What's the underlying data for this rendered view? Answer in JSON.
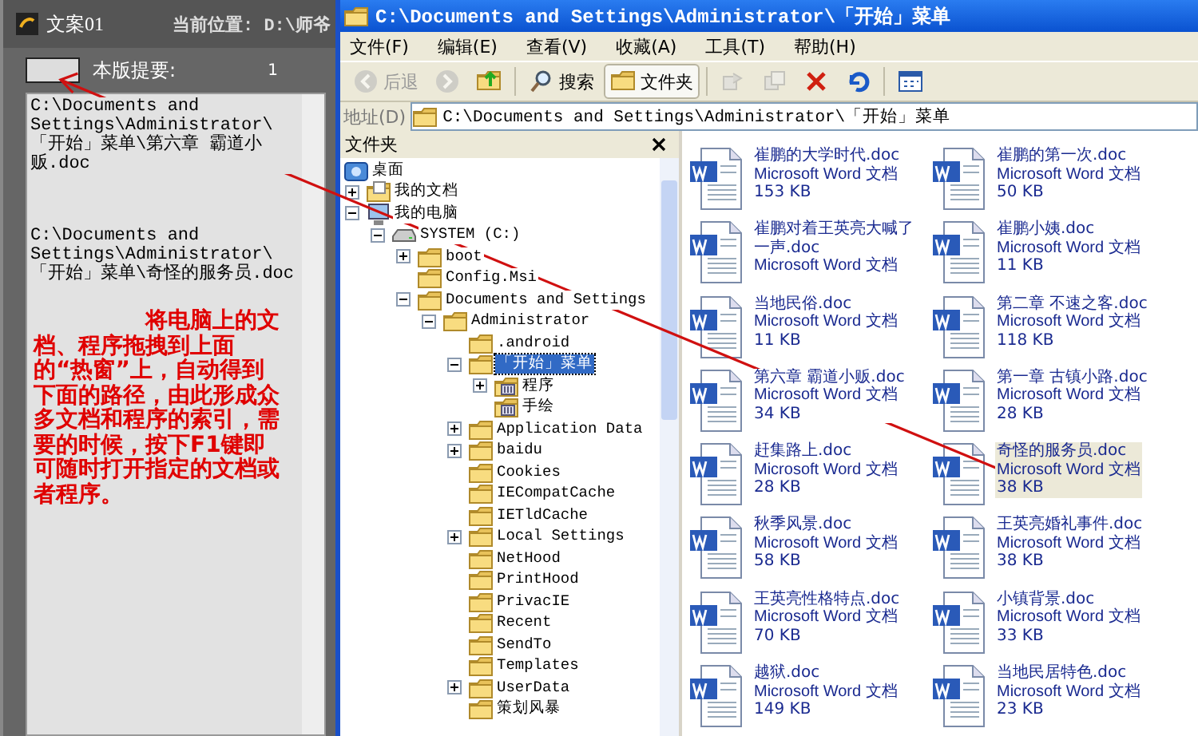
{
  "hot_window": {
    "title": "文案01",
    "location": "当前位置: D:\\师爷",
    "summary_label": "本版提要:",
    "summary_count": "1",
    "paths": [
      "C:\\Documents and Settings\\Administrator\\「开始」菜单\\第六章 霸道小贩.doc",
      "C:\\Documents and Settings\\Administrator\\「开始」菜单\\奇怪的服务员.doc"
    ],
    "instructions": "将电脑上的文档、程序拖拽到上面的“热窗”上，自动得到下面的路径，由此形成众多文档和程序的索引，需要的时候，按下F1键即可随时打开指定的文档或者程序。"
  },
  "explorer": {
    "title": "C:\\Documents and Settings\\Administrator\\「开始」菜单",
    "menu": [
      "文件(F)",
      "编辑(E)",
      "查看(V)",
      "收藏(A)",
      "工具(T)",
      "帮助(H)"
    ],
    "toolbar": [
      {
        "kind": "back",
        "label": "后退",
        "disabled": true,
        "pressed": false
      },
      {
        "kind": "forward",
        "disabled": true,
        "pressed": false
      },
      {
        "kind": "up",
        "disabled": false,
        "pressed": false
      },
      {
        "kind": "search",
        "label": "搜索",
        "disabled": false,
        "pressed": false
      },
      {
        "kind": "folders",
        "label": "文件夹",
        "disabled": false,
        "pressed": true
      },
      {
        "kind": "move",
        "disabled": true,
        "pressed": false
      },
      {
        "kind": "copy",
        "disabled": true,
        "pressed": false
      },
      {
        "kind": "delete",
        "disabled": false,
        "pressed": false
      },
      {
        "kind": "undo",
        "disabled": false,
        "pressed": false
      },
      {
        "kind": "views",
        "disabled": false,
        "pressed": false
      }
    ],
    "address": {
      "label": "地址(D)",
      "value": "C:\\Documents and Settings\\Administrator\\「开始」菜单"
    },
    "folders_pane": {
      "title": "文件夹",
      "tree": [
        {
          "label": "桌面",
          "kind": "desktop",
          "selected": false,
          "children": [
            {
              "label": "我的文档",
              "kind": "documents",
              "expanded": false,
              "selected": false
            },
            {
              "label": "我的电脑",
              "kind": "computer",
              "expanded": true,
              "selected": false,
              "children": [
                {
                  "label": "SYSTEM (C:)",
                  "kind": "drive",
                  "expanded": true,
                  "selected": false,
                  "children": [
                    {
                      "label": "boot",
                      "kind": "folder",
                      "expanded": false,
                      "selected": false
                    },
                    {
                      "label": "Config.Msi",
                      "kind": "folder",
                      "selected": false
                    },
                    {
                      "label": "Documents and Settings",
                      "kind": "folder",
                      "expanded": true,
                      "selected": false,
                      "children": [
                        {
                          "label": "Administrator",
                          "kind": "folder",
                          "expanded": true,
                          "selected": false,
                          "children": [
                            {
                              "label": ".android",
                              "kind": "folder",
                              "selected": false
                            },
                            {
                              "label": "「开始」菜单",
                              "kind": "folder",
                              "expanded": true,
                              "selected": true,
                              "children": [
                                {
                                  "label": "程序",
                                  "kind": "program-folder",
                                  "expanded": false,
                                  "selected": false
                                },
                                {
                                  "label": "手绘",
                                  "kind": "program-folder",
                                  "selected": false
                                }
                              ]
                            },
                            {
                              "label": "Application Data",
                              "kind": "folder",
                              "expanded": false,
                              "selected": false
                            },
                            {
                              "label": "baidu",
                              "kind": "folder",
                              "expanded": false,
                              "selected": false
                            },
                            {
                              "label": "Cookies",
                              "kind": "folder",
                              "selected": false
                            },
                            {
                              "label": "IECompatCache",
                              "kind": "folder",
                              "selected": false
                            },
                            {
                              "label": "IETldCache",
                              "kind": "folder",
                              "selected": false
                            },
                            {
                              "label": "Local Settings",
                              "kind": "folder",
                              "expanded": false,
                              "selected": false
                            },
                            {
                              "label": "NetHood",
                              "kind": "folder",
                              "selected": false
                            },
                            {
                              "label": "PrintHood",
                              "kind": "folder",
                              "selected": false
                            },
                            {
                              "label": "PrivacIE",
                              "kind": "folder",
                              "selected": false
                            },
                            {
                              "label": "Recent",
                              "kind": "folder",
                              "selected": false
                            },
                            {
                              "label": "SendTo",
                              "kind": "folder",
                              "selected": false
                            },
                            {
                              "label": "Templates",
                              "kind": "folder",
                              "selected": false
                            },
                            {
                              "label": "UserData",
                              "kind": "folder",
                              "expanded": false,
                              "selected": false
                            },
                            {
                              "label": "策划风暴",
                              "kind": "folder",
                              "selected": false
                            }
                          ]
                        }
                      ]
                    }
                  ]
                }
              ]
            }
          ]
        }
      ]
    },
    "files": [
      {
        "name": "崔鹏的大学时代.doc",
        "type": "Microsoft Word 文档",
        "size": "153 KB",
        "selected": false
      },
      {
        "name": "崔鹏的第一次.doc",
        "type": "Microsoft Word 文档",
        "size": "50 KB",
        "selected": false
      },
      {
        "name": "崔鹏对着王英亮大喊了一声.doc",
        "type": "Microsoft Word 文档",
        "selected": false
      },
      {
        "name": "崔鹏小姨.doc",
        "type": "Microsoft Word 文档",
        "size": "11 KB",
        "selected": false
      },
      {
        "name": "当地民俗.doc",
        "type": "Microsoft Word 文档",
        "size": "11 KB",
        "selected": false
      },
      {
        "name": "第二章 不速之客.doc",
        "type": "Microsoft Word 文档",
        "size": "118 KB",
        "selected": false
      },
      {
        "name": "第六章 霸道小贩.doc",
        "type": "Microsoft Word 文档",
        "size": "34 KB",
        "selected": false
      },
      {
        "name": "第一章 古镇小路.doc",
        "type": "Microsoft Word 文档",
        "size": "28 KB",
        "selected": false
      },
      {
        "name": "赶集路上.doc",
        "type": "Microsoft Word 文档",
        "size": "28 KB",
        "selected": false
      },
      {
        "name": "奇怪的服务员.doc",
        "type": "Microsoft Word 文档",
        "size": "38 KB",
        "selected": true
      },
      {
        "name": "秋季风景.doc",
        "type": "Microsoft Word 文档",
        "size": "58 KB",
        "selected": false
      },
      {
        "name": "王英亮婚礼事件.doc",
        "type": "Microsoft Word 文档",
        "size": "38 KB",
        "selected": false
      },
      {
        "name": "王英亮性格特点.doc",
        "type": "Microsoft Word 文档",
        "size": "70 KB",
        "selected": false
      },
      {
        "name": "小镇背景.doc",
        "type": "Microsoft Word 文档",
        "size": "33 KB",
        "selected": false
      },
      {
        "name": "越狱.doc",
        "type": "Microsoft Word 文档",
        "size": "149 KB",
        "selected": false
      },
      {
        "name": "当地民居特色.doc",
        "type": "Microsoft Word 文档",
        "size": "23 KB",
        "selected": false
      }
    ]
  }
}
